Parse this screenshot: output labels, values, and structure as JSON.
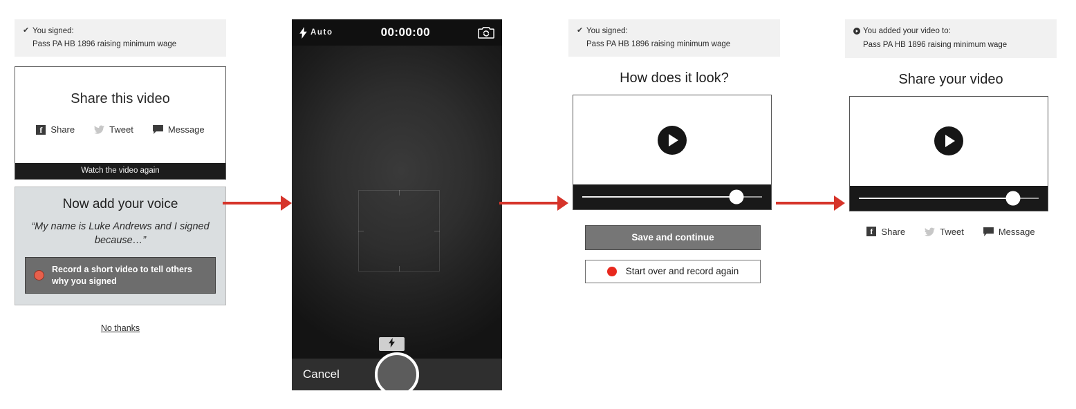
{
  "panels": {
    "share_prompt": {
      "banner": {
        "icon": "check-icon",
        "icon_glyph": "✔",
        "line1": "You signed:",
        "line2": "Pass PA HB 1896 raising minimum wage"
      },
      "share_card": {
        "title": "Share this video",
        "actions": [
          {
            "icon": "facebook-icon",
            "label": "Share"
          },
          {
            "icon": "twitter-icon",
            "label": "Tweet"
          },
          {
            "icon": "message-icon",
            "label": "Message"
          }
        ],
        "watch_again": "Watch the video again"
      },
      "voice_card": {
        "title": "Now add your voice",
        "quote": "“My name is Luke Andrews and I signed because…”",
        "record_button": {
          "icon": "record-dot-icon",
          "label": "Record a short video to tell others why you signed"
        }
      },
      "decline_link": "No thanks"
    },
    "camera": {
      "flash_mode": "Auto",
      "flash_icon": "lightning-bolt-icon",
      "timer": "00:00:00",
      "flip_icon": "camera-flip-icon",
      "focus_icon": "focus-square-icon",
      "flash_toggle_icon": "lightning-bolt-icon",
      "cancel_label": "Cancel",
      "shutter_icon": "shutter-button-icon"
    },
    "review": {
      "banner": {
        "icon": "check-icon",
        "icon_glyph": "✔",
        "line1": "You signed:",
        "line2": "Pass PA HB 1896 raising minimum wage"
      },
      "headline": "How does it look?",
      "player": {
        "play_icon": "play-button-icon",
        "scrubber_icon": "scrubber-handle-icon",
        "progress_percent": 82
      },
      "primary_button": "Save and continue",
      "secondary_button": {
        "icon": "record-dot-icon",
        "label": "Start over and record again"
      }
    },
    "share_video": {
      "banner": {
        "icon": "video-icon",
        "icon_glyph": "◉",
        "line1": "You added your video to:",
        "line2": "Pass PA HB 1896 raising minimum wage"
      },
      "headline": "Share your video",
      "player": {
        "play_icon": "play-button-icon",
        "scrubber_icon": "scrubber-handle-icon",
        "progress_percent": 82
      },
      "actions": [
        {
          "icon": "facebook-icon",
          "label": "Share"
        },
        {
          "icon": "twitter-icon",
          "label": "Tweet"
        },
        {
          "icon": "message-icon",
          "label": "Message"
        }
      ]
    }
  },
  "flow": {
    "arrows": [
      {
        "name": "arrow-step-1-to-2"
      },
      {
        "name": "arrow-step-2-to-3"
      },
      {
        "name": "arrow-step-3-to-4"
      }
    ]
  },
  "colors": {
    "arrow_red": "#d6342a",
    "record_red": "#e8604c",
    "banner_bg": "#f1f1f1",
    "voice_card_bg": "#dadee0",
    "primary_button_bg": "#767676",
    "dark_bar": "#1c1c1c"
  }
}
